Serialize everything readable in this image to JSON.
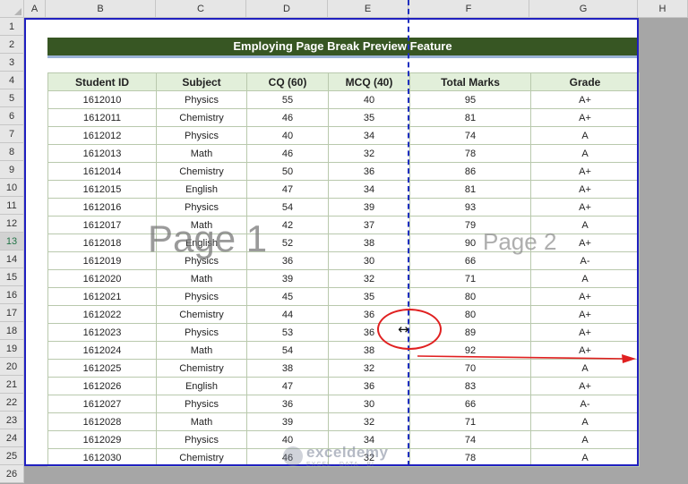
{
  "columns": [
    "A",
    "B",
    "C",
    "D",
    "E",
    "F",
    "G",
    "H"
  ],
  "rows": [
    "1",
    "2",
    "3",
    "4",
    "5",
    "6",
    "7",
    "8",
    "9",
    "10",
    "11",
    "12",
    "13",
    "14",
    "15",
    "16",
    "17",
    "18",
    "19",
    "20",
    "21",
    "22",
    "23",
    "24",
    "25",
    "26"
  ],
  "title": "Employing Page Break Preview Feature",
  "headers": [
    "Student ID",
    "Subject",
    "CQ (60)",
    "MCQ (40)",
    "Total Marks",
    "Grade"
  ],
  "records": [
    [
      "1612010",
      "Physics",
      "55",
      "40",
      "95",
      "A+"
    ],
    [
      "1612011",
      "Chemistry",
      "46",
      "35",
      "81",
      "A+"
    ],
    [
      "1612012",
      "Physics",
      "40",
      "34",
      "74",
      "A"
    ],
    [
      "1612013",
      "Math",
      "46",
      "32",
      "78",
      "A"
    ],
    [
      "1612014",
      "Chemistry",
      "50",
      "36",
      "86",
      "A+"
    ],
    [
      "1612015",
      "English",
      "47",
      "34",
      "81",
      "A+"
    ],
    [
      "1612016",
      "Physics",
      "54",
      "39",
      "93",
      "A+"
    ],
    [
      "1612017",
      "Math",
      "42",
      "37",
      "79",
      "A"
    ],
    [
      "1612018",
      "English",
      "52",
      "38",
      "90",
      "A+"
    ],
    [
      "1612019",
      "Physics",
      "36",
      "30",
      "66",
      "A-"
    ],
    [
      "1612020",
      "Math",
      "39",
      "32",
      "71",
      "A"
    ],
    [
      "1612021",
      "Physics",
      "45",
      "35",
      "80",
      "A+"
    ],
    [
      "1612022",
      "Chemistry",
      "44",
      "36",
      "80",
      "A+"
    ],
    [
      "1612023",
      "Physics",
      "53",
      "36",
      "89",
      "A+"
    ],
    [
      "1612024",
      "Math",
      "54",
      "38",
      "92",
      "A+"
    ],
    [
      "1612025",
      "Chemistry",
      "38",
      "32",
      "70",
      "A"
    ],
    [
      "1612026",
      "English",
      "47",
      "36",
      "83",
      "A+"
    ],
    [
      "1612027",
      "Physics",
      "36",
      "30",
      "66",
      "A-"
    ],
    [
      "1612028",
      "Math",
      "39",
      "32",
      "71",
      "A"
    ],
    [
      "1612029",
      "Physics",
      "40",
      "34",
      "74",
      "A"
    ],
    [
      "1612030",
      "Chemistry",
      "46",
      "32",
      "78",
      "A"
    ]
  ],
  "watermarks": {
    "page1": "Page 1",
    "page2": "Page 2"
  },
  "cursor_icon": "resize-horizontal-icon",
  "logo": {
    "name": "exceldemy",
    "tagline": "EXCEL · DATA · BI"
  },
  "colors": {
    "title_fill": "#375623",
    "header_fill": "#e2efda",
    "page_border": "#2020c0",
    "annotation": "#e02020"
  },
  "selected_row": "13"
}
